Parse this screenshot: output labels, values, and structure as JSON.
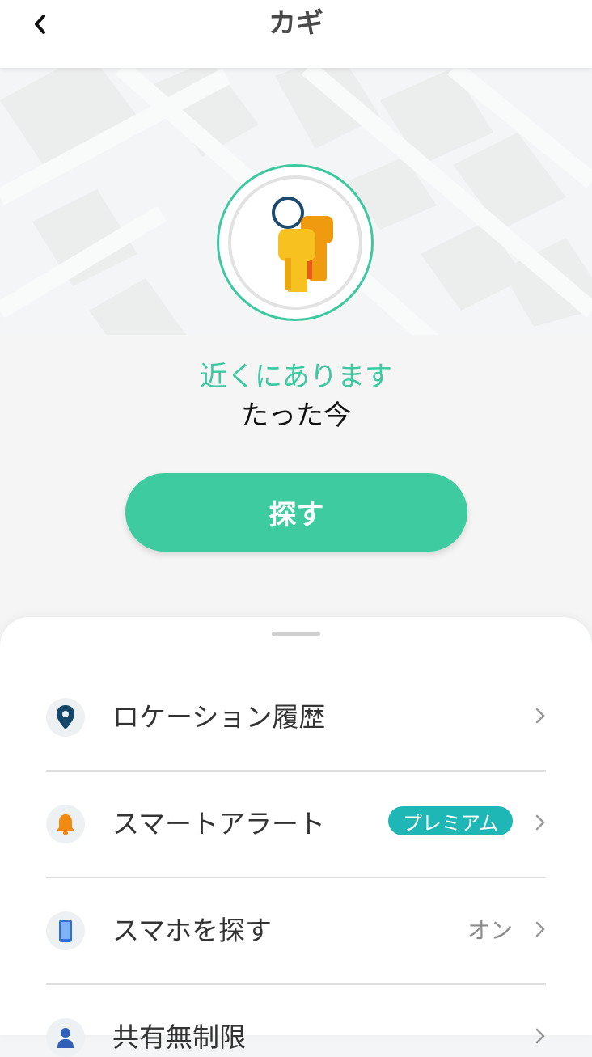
{
  "header": {
    "title": "カギ"
  },
  "item": {
    "status": "近くにあります",
    "last_seen": "たった今",
    "find_button_label": "探す"
  },
  "colors": {
    "accent": "#3ecb9f",
    "badge": "#1fb6b6"
  },
  "menu": [
    {
      "label": "ロケーション履歴",
      "icon": "location-pin-icon"
    },
    {
      "label": "スマートアラート",
      "icon": "bell-icon",
      "badge": "プレミアム"
    },
    {
      "label": "スマホを探す",
      "icon": "phone-icon",
      "value": "オン"
    },
    {
      "label": "共有無制限",
      "icon": "person-icon"
    }
  ]
}
